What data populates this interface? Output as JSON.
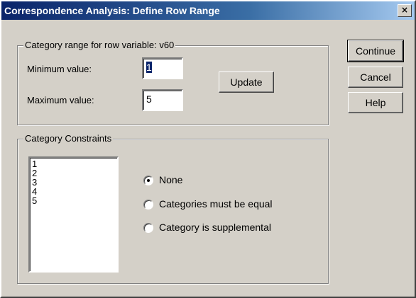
{
  "window": {
    "title": "Correspondence Analysis: Define Row Range",
    "close_glyph": "×"
  },
  "range_group": {
    "legend": "Category range for row variable:  v60",
    "min_label": "Minimum value:",
    "min_value": "1",
    "max_label": "Maximum value:",
    "max_value": "5",
    "update_label": "Update"
  },
  "side_buttons": {
    "continue_label": "Continue",
    "cancel_label": "Cancel",
    "help_label": "Help"
  },
  "constraints_group": {
    "legend": "Category Constraints",
    "categories": [
      "1",
      "2",
      "3",
      "4",
      "5"
    ],
    "options": [
      {
        "label": "None",
        "selected": true
      },
      {
        "label": "Categories must be equal",
        "selected": false
      },
      {
        "label": "Category is supplemental",
        "selected": false
      }
    ]
  }
}
